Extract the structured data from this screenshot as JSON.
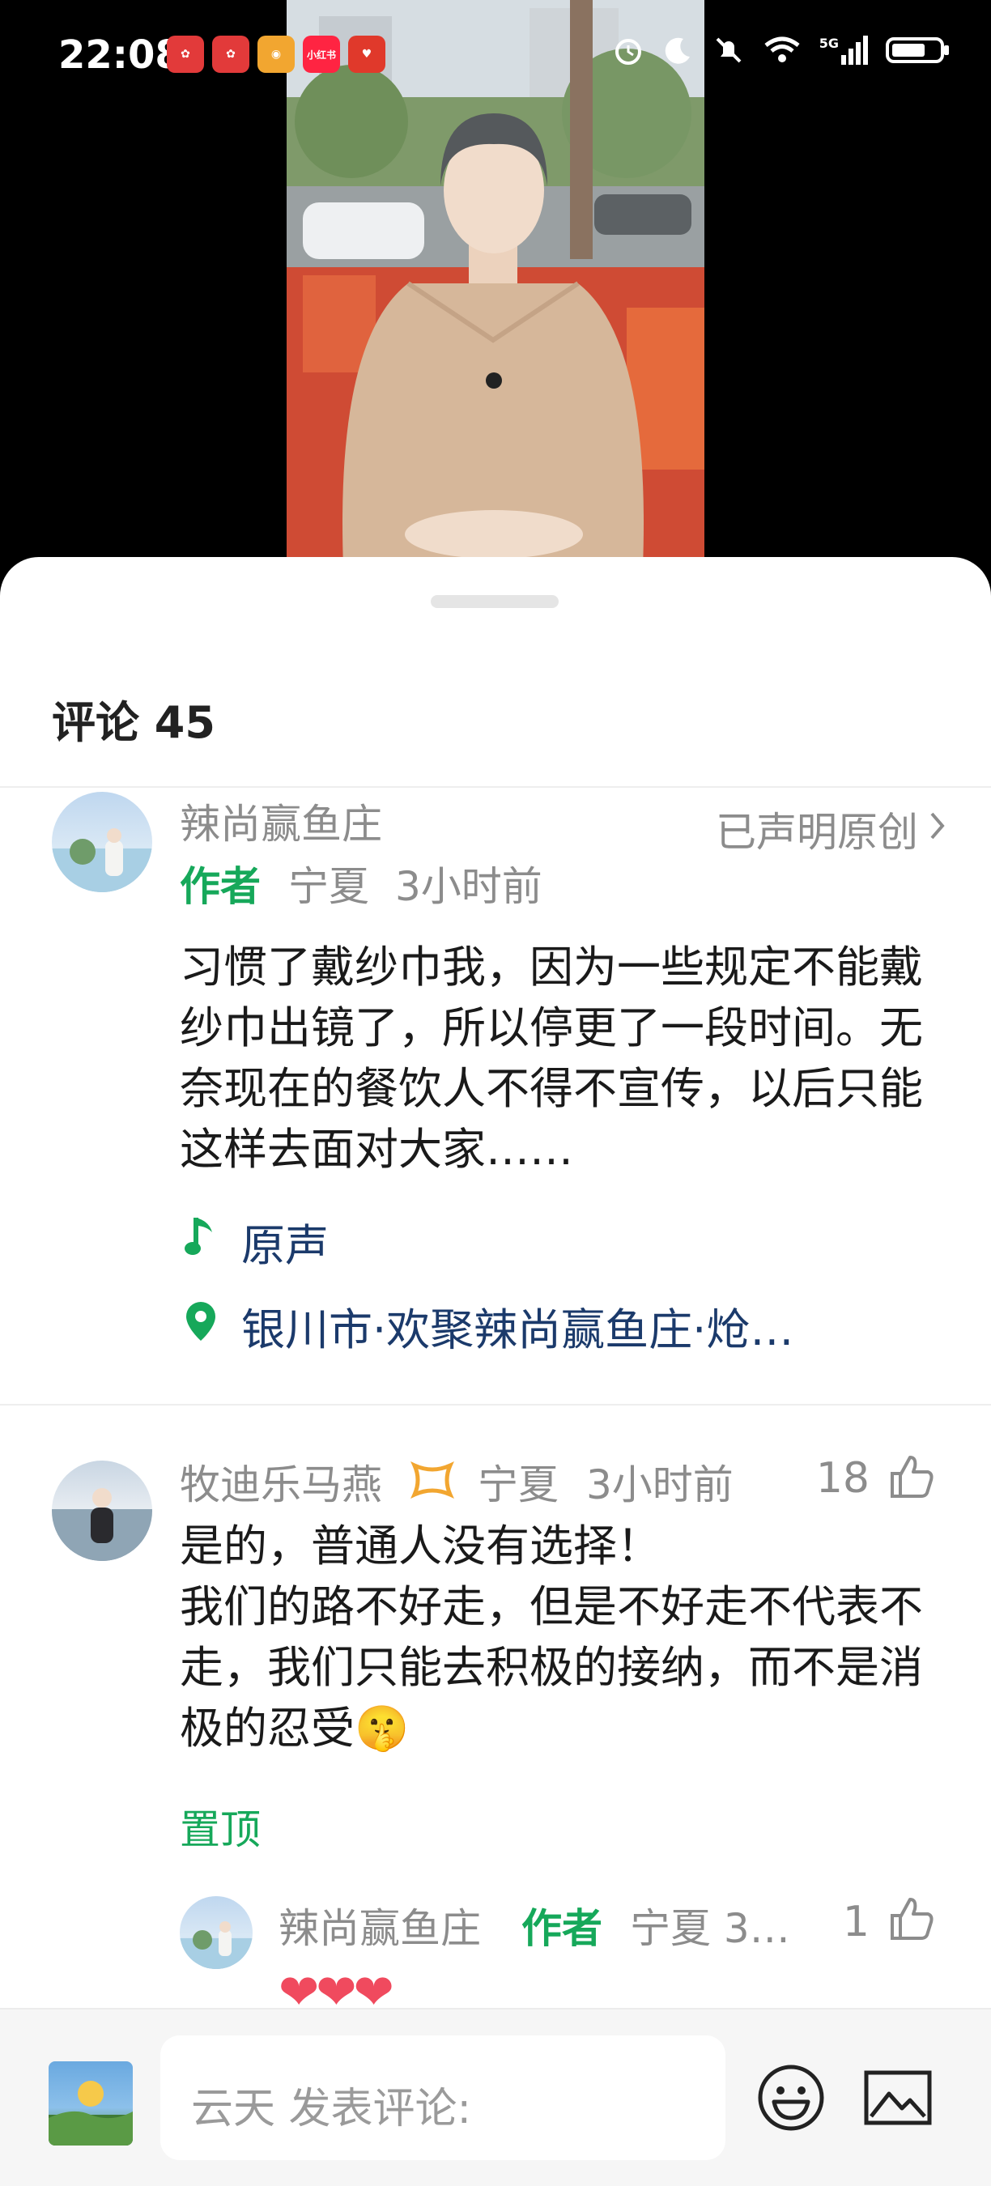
{
  "status_bar": {
    "time": "22:08",
    "app_icons": [
      "weibo-red-icon",
      "weibo-red-icon",
      "weibo-icon",
      "xiaohongshu-icon",
      "pinduoduo-icon"
    ],
    "xiaohongshu_label": "小红书",
    "network_label": "5G"
  },
  "sheet": {
    "title": "评论 45"
  },
  "post": {
    "author_name": "辣尚赢鱼庄",
    "author_tag": "作者",
    "location": "宁夏",
    "time_ago": "3小时前",
    "original_claim": "已声明原创",
    "text": "习惯了戴纱巾我，因为一些规定不能戴纱巾出镜了，所以停更了一段时间。无奈现在的餐饮人不得不宣传，以后只能这样去面对大家……",
    "music_label": "原声",
    "place_label": "银川市·欢聚辣尚赢鱼庄·炝…"
  },
  "comments": [
    {
      "user_name": "牧迪乐马燕",
      "location": "宁夏",
      "time_ago": "3小时前",
      "likes": "18",
      "text": "是的，普通人没有选择！\n我们的路不好走，但是不好走不代表不走，我们只能去积极的接纳，而不是消极的忍受🤫",
      "pinned_label": "置顶",
      "reply": {
        "user_name": "辣尚赢鱼庄",
        "author_tag": "作者",
        "location_time": "宁夏 3…",
        "likes": "1",
        "emoji": "❤❤❤"
      }
    }
  ],
  "bottom_bar": {
    "placeholder": "云天 发表评论:"
  },
  "colors": {
    "accent_green": "#16a85a",
    "link_blue": "#1b3a6b",
    "gray_text": "#8c8c8c"
  }
}
